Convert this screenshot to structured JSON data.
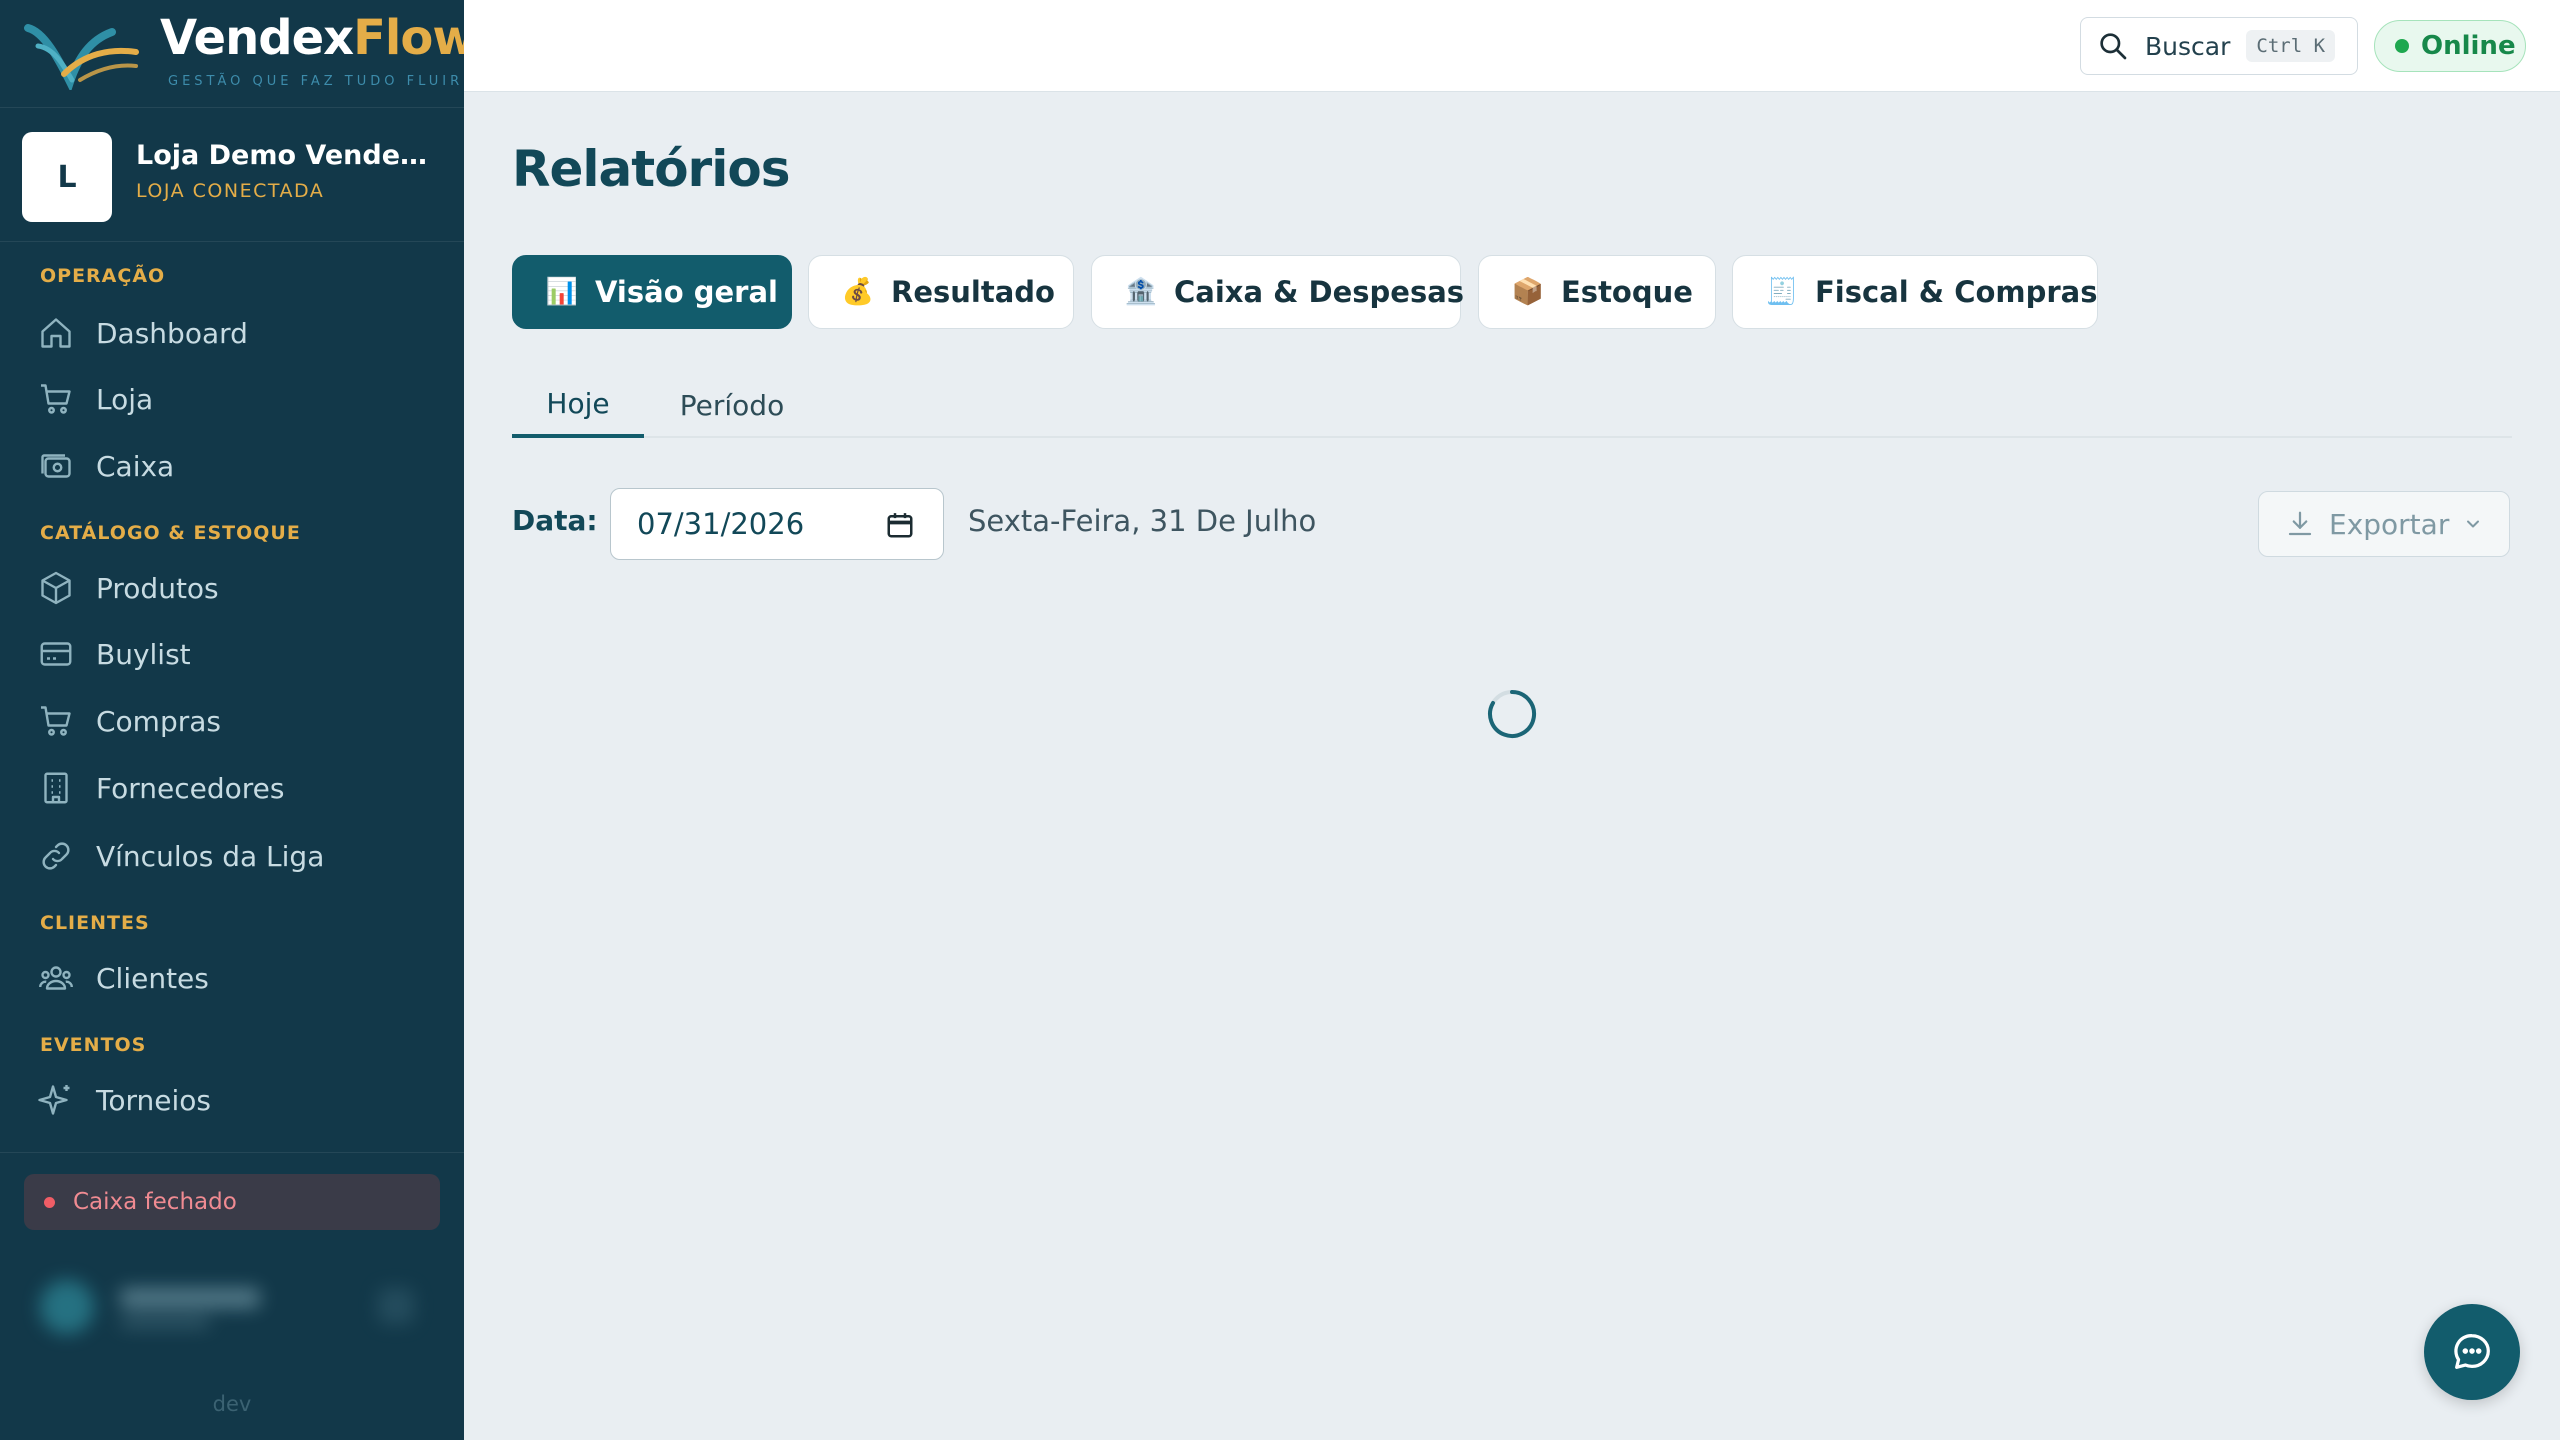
{
  "brand": {
    "name_part1": "Vendex",
    "name_part2": "Flow",
    "tagline": "GESTÃO QUE FAZ TUDO FLUIR"
  },
  "store": {
    "avatar_letter": "L",
    "name": "Loja Demo VendexFl...",
    "status": "LOJA CONECTADA"
  },
  "sidebar": {
    "sections": [
      {
        "title": "OPERAÇÃO",
        "items": [
          {
            "label": "Dashboard",
            "icon": "home-icon"
          },
          {
            "label": "Loja",
            "icon": "cart-icon"
          },
          {
            "label": "Caixa",
            "icon": "cash-register-icon"
          }
        ]
      },
      {
        "title": "CATÁLOGO & ESTOQUE",
        "items": [
          {
            "label": "Produtos",
            "icon": "box-icon"
          },
          {
            "label": "Buylist",
            "icon": "card-icon"
          },
          {
            "label": "Compras",
            "icon": "cart-icon"
          },
          {
            "label": "Fornecedores",
            "icon": "building-icon"
          },
          {
            "label": "Vínculos da Liga",
            "icon": "link-icon"
          }
        ]
      },
      {
        "title": "CLIENTES",
        "items": [
          {
            "label": "Clientes",
            "icon": "users-icon"
          }
        ]
      },
      {
        "title": "EVENTOS",
        "items": [
          {
            "label": "Torneios",
            "icon": "sparkle-icon"
          }
        ]
      }
    ],
    "caixa_status": "Caixa fechado",
    "env": "dev"
  },
  "topbar": {
    "search_label": "Buscar",
    "search_shortcut": "Ctrl K",
    "online_label": "Online"
  },
  "main": {
    "title": "Relatórios",
    "report_tabs": [
      {
        "label": "Visão geral",
        "emoji": "📊",
        "active": true
      },
      {
        "label": "Resultado",
        "emoji": "💰",
        "active": false
      },
      {
        "label": "Caixa & Despesas",
        "emoji": "🏦",
        "active": false
      },
      {
        "label": "Estoque",
        "emoji": "📦",
        "active": false
      },
      {
        "label": "Fiscal & Compras",
        "emoji": "🧾",
        "active": false
      }
    ],
    "sub_tabs": [
      {
        "label": "Hoje",
        "active": true
      },
      {
        "label": "Período",
        "active": false
      }
    ],
    "date_label": "Data:",
    "date_value": "07/31/2026",
    "date_long": "Sexta-Feira, 31 De Julho",
    "export_label": "Exportar"
  },
  "colors": {
    "sidebar_bg": "#123849",
    "accent": "#125c6c",
    "gold": "#e4ad48",
    "online_green": "#1ea84f",
    "danger": "#f05d66"
  }
}
